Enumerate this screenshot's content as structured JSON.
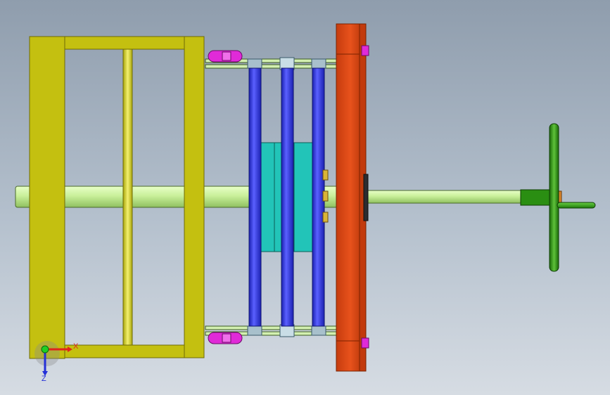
{
  "viewport": {
    "background_top": "#8f9dad",
    "background_bottom": "#d6dce3"
  },
  "model": {
    "colors": {
      "frame": "#c4c010",
      "frame_edge": "#6e6a06",
      "shaft": "#c9f09a",
      "shaft_edge": "#4a6a2a",
      "guide_rod": "#2b31e0",
      "guide_rod_edge": "#10146e",
      "block": "#22c4b8",
      "block_edge": "#0c5e58",
      "plate": "#e24a14",
      "plate_edge": "#7a2200",
      "bracket": "#e02ad8",
      "bracket_edge": "#6a0c66",
      "handwheel": "#2a8e12",
      "handwheel_edge": "#0e3e04",
      "bolt": "#d9b436"
    }
  },
  "triad": {
    "x_label": "X",
    "z_label": "Z",
    "x_color": "#e0241c",
    "y_color": "#1fcf24",
    "z_color": "#2430d8"
  }
}
